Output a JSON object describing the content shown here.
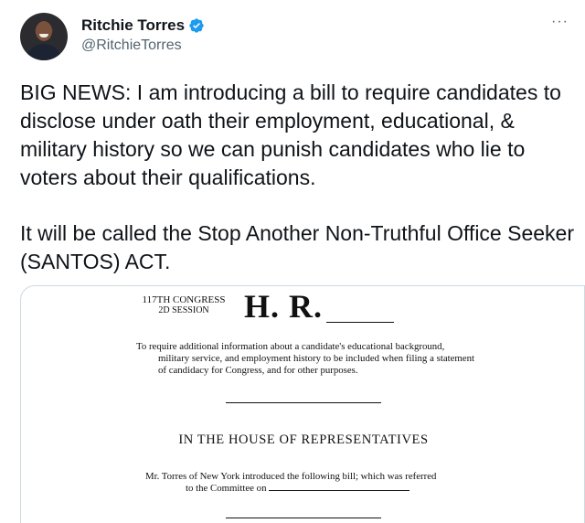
{
  "author": {
    "display_name": "Ritchie Torres",
    "handle": "@RitchieTorres",
    "verified": true
  },
  "menu": {
    "more_label": "···"
  },
  "tweet": {
    "paragraph_1": "BIG NEWS: I am introducing a bill to require candidates to disclose under oath their employment, educational, & military history so we can punish candidates who lie to voters about their qualifications.",
    "paragraph_2": "It will be called the Stop Another Non-Truthful Office Seeker (SANTOS) ACT."
  },
  "document": {
    "congress": "117th Congress",
    "session": "2d Session",
    "bill_title": "H. R.",
    "purpose_line_1": "To require additional information about a candidate's educational background,",
    "purpose_line_2": "military service, and employment history to be included when filing a statement of candidacy for Congress, and for other purposes.",
    "house": "IN THE HOUSE OF REPRESENTATIVES",
    "intro_part_1": "Mr. Torres of New York introduced the following bill; which was referred",
    "intro_part_2": "to the Committee on"
  },
  "colors": {
    "text": "#0f1419",
    "secondary_text": "#536471",
    "verified_badge": "#1d9bf0",
    "border": "#cfd9de"
  },
  "icons": [
    "avatar",
    "verified-badge-icon",
    "more-icon"
  ]
}
